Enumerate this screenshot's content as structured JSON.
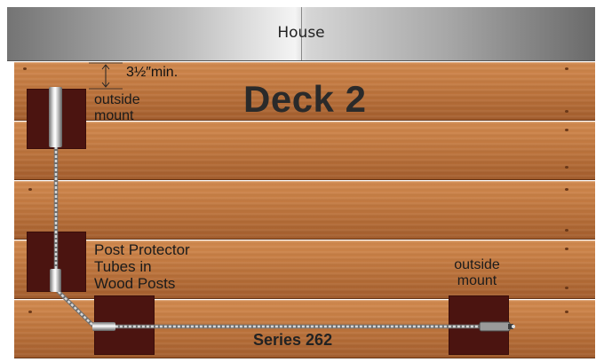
{
  "house": {
    "label": "House"
  },
  "deck": {
    "title": "Deck 2",
    "series": "Series 262"
  },
  "annotations": {
    "min_spacing": "3½″min.",
    "outside_mount_left_line1": "outside",
    "outside_mount_left_line2": "mount",
    "outside_mount_right_line1": "outside",
    "outside_mount_right_line2": "mount",
    "post_protector_line1": "Post Protector",
    "post_protector_line2": "Tubes in",
    "post_protector_line3": "Wood Posts"
  },
  "colors": {
    "wood": "#c47b42",
    "post": "#4b1410",
    "cable": "#c8c8c8",
    "house_light": "#f4f4f4",
    "house_dark": "#6a6a6a"
  }
}
